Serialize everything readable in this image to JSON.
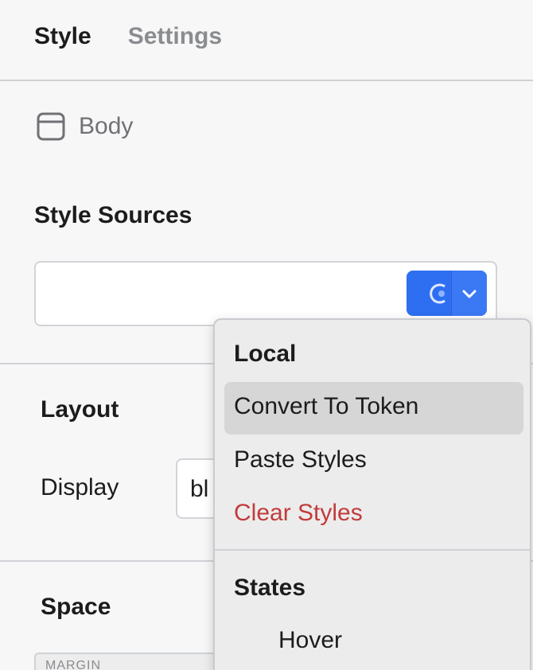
{
  "tabs": [
    {
      "label": "Style",
      "active": true
    },
    {
      "label": "Settings",
      "active": false
    }
  ],
  "selection": {
    "icon": "box-icon",
    "label": "Body"
  },
  "style_sources": {
    "title": "Style Sources",
    "input_value": "",
    "token_button_icon": "token-icon",
    "dropdown_icon": "chevron-down-icon"
  },
  "layout": {
    "title": "Layout",
    "display_label": "Display",
    "display_value": "bl"
  },
  "space": {
    "title": "Space",
    "margin_label": "MARGIN"
  },
  "menu": {
    "local_heading": "Local",
    "items": [
      {
        "label": "Convert To Token",
        "highlighted": true
      },
      {
        "label": "Paste Styles"
      },
      {
        "label": "Clear Styles",
        "color": "#c23b3b"
      }
    ],
    "states_heading": "States",
    "states": [
      {
        "label": "Hover"
      }
    ]
  },
  "colors": {
    "accent": "#2e6ff2",
    "danger": "#c23b3b",
    "muted": "#8a8c90"
  }
}
